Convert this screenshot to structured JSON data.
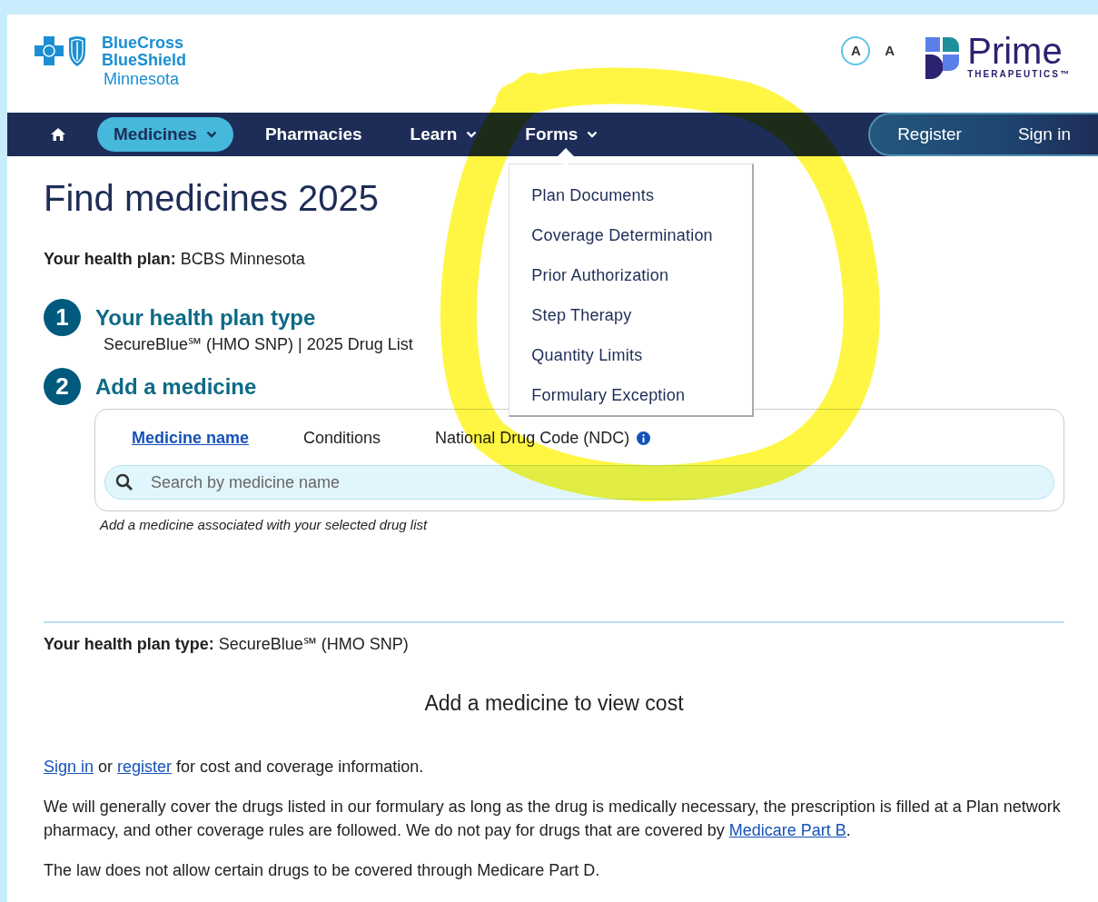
{
  "header": {
    "brand": {
      "lines": [
        "BlueCross",
        "BlueShield"
      ],
      "region": "Minnesota"
    },
    "text_size_buttons": [
      {
        "label": "A",
        "selected": true
      },
      {
        "label": "A",
        "selected": false
      }
    ],
    "partner": {
      "name": "Prime",
      "tagline": "THERAPEUTICS™"
    }
  },
  "nav": {
    "items": [
      {
        "kind": "home",
        "selected": false
      },
      {
        "kind": "menu",
        "label": "Medicines",
        "dropdown": true,
        "selected": true
      },
      {
        "kind": "link",
        "label": "Pharmacies",
        "selected": false
      },
      {
        "kind": "menu",
        "label": "Learn",
        "dropdown": true,
        "selected": false
      },
      {
        "kind": "menu",
        "label": "Forms",
        "dropdown": true,
        "selected": false,
        "expanded": true
      }
    ],
    "account": [
      "Register",
      "Sign in"
    ]
  },
  "forms_menu": [
    "Plan Documents",
    "Coverage Determination",
    "Prior Authorization",
    "Step Therapy",
    "Quantity Limits",
    "Formulary Exception"
  ],
  "title": "Find medicines 2025",
  "health_plan": {
    "label": "Your health plan:",
    "value": "BCBS Minnesota"
  },
  "steps": [
    {
      "number": "1",
      "title": "Your health plan type",
      "detail": "SecureBlue℠ (HMO SNP) | 2025 Drug List"
    },
    {
      "number": "2",
      "title": "Add a medicine"
    }
  ],
  "search_tabs": [
    {
      "label": "Medicine name",
      "selected": true,
      "info": false
    },
    {
      "label": "Conditions",
      "selected": false,
      "info": false
    },
    {
      "label": "National Drug Code (NDC)",
      "selected": false,
      "info": true
    }
  ],
  "search": {
    "placeholder": "Search by medicine name"
  },
  "search_hint": "Add a medicine associated with your selected drug list",
  "plan_type": {
    "label": "Your health plan type:",
    "value": "SecureBlue℠ (HMO SNP)"
  },
  "cost_heading": "Add a medicine to view cost",
  "paragraphs": [
    [
      {
        "kind": "link",
        "text": "Sign in"
      },
      {
        "kind": "text",
        "text": " or "
      },
      {
        "kind": "link",
        "text": "register"
      },
      {
        "kind": "text",
        "text": " for cost and coverage information."
      }
    ],
    [
      {
        "kind": "text",
        "text": "We will generally cover the drugs listed in our formulary as long as the drug is medically necessary, the prescription is filled at a Plan network pharmacy, and other coverage rules are followed. We do not pay for drugs that are covered by "
      },
      {
        "kind": "link",
        "text": "Medicare Part B"
      },
      {
        "kind": "text",
        "text": "."
      }
    ],
    [
      {
        "kind": "text",
        "text": "The law does not allow certain drugs to be covered through Medicare Part D."
      }
    ]
  ]
}
